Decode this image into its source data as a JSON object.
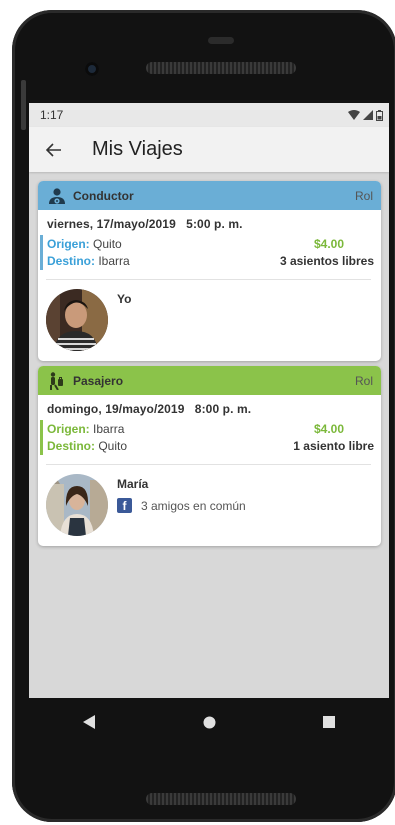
{
  "status": {
    "time": "1:17"
  },
  "appbar": {
    "title": "Mis Viajes"
  },
  "trips": [
    {
      "role": "Conductor",
      "role_tag": "Rol",
      "header_color": "#6aaed6",
      "bar_color": "#6aaed6",
      "date": "viernes, 17/mayo/2019",
      "time": "5:00 p. m.",
      "origin_label": "Origen:",
      "origin": "Quito",
      "destination_label": "Destino:",
      "destination": "Ibarra",
      "price": "$4.00",
      "seats": "3 asientos libres",
      "person_name": "Yo",
      "role_icon": "driver-icon"
    },
    {
      "role": "Pasajero",
      "role_tag": "Rol",
      "header_color": "#8bc34a",
      "bar_color": "#8bc34a",
      "date": "domingo, 19/mayo/2019",
      "time": "8:00 p. m.",
      "origin_label": "Origen:",
      "origin": "Ibarra",
      "destination_label": "Destino:",
      "destination": "Quito",
      "price": "$4.00",
      "seats": "1 asiento libre",
      "person_name": "María",
      "mutual_friends": "3 amigos en común",
      "role_icon": "passenger-icon"
    }
  ],
  "colors": {
    "label_blue": "#3aa0d8",
    "label_green": "#7bb83a",
    "price_green": "#7bb83a"
  }
}
